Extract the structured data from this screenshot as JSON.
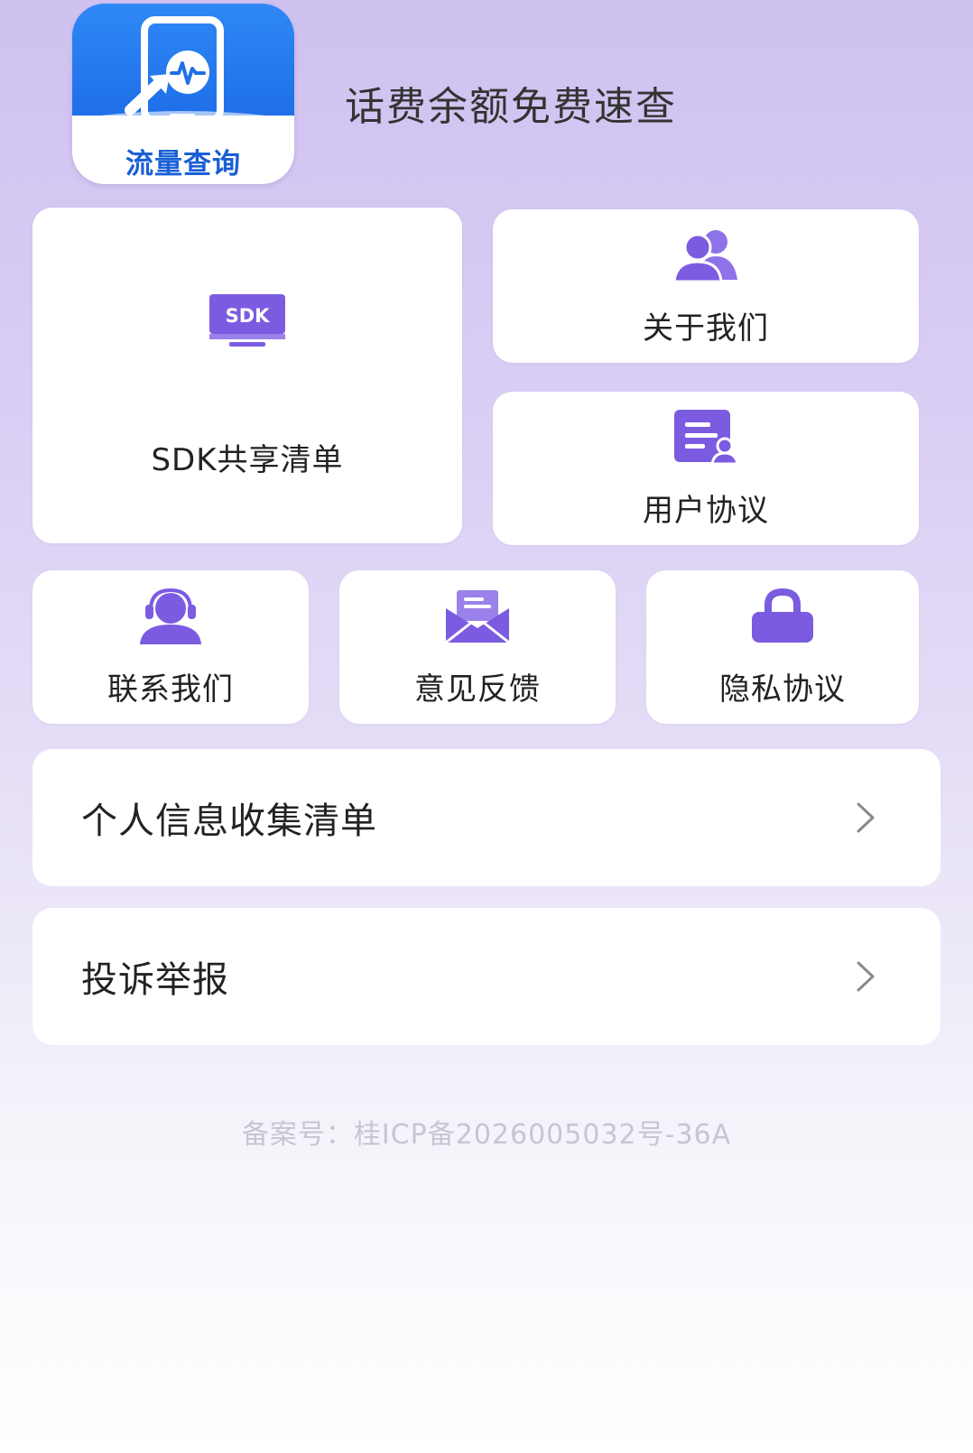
{
  "header": {
    "logo_text": "流量查询",
    "title": "话费余额免费速查"
  },
  "grid": {
    "sdk": {
      "label": "SDK共享清单",
      "icon_text": "SDK",
      "icon": "sdk-icon"
    },
    "about": {
      "label": "关于我们",
      "icon": "users-icon"
    },
    "agreement": {
      "label": "用户协议",
      "icon": "document-user-icon"
    },
    "contact": {
      "label": "联系我们",
      "icon": "headset-icon"
    },
    "feedback": {
      "label": "意见反馈",
      "icon": "envelope-icon"
    },
    "privacy": {
      "label": "隐私协议",
      "icon": "lock-icon"
    }
  },
  "list": {
    "personal_info": {
      "label": "个人信息收集清单",
      "icon": "chevron-right-icon"
    },
    "complaint": {
      "label": "投诉举报",
      "icon": "chevron-right-icon"
    }
  },
  "footer": {
    "icp": "备案号：桂ICP备2026005032号-36A"
  },
  "colors": {
    "accent": "#7b5ce0",
    "logo_blue": "#1f6fe8",
    "background_top": "#cfc1f0",
    "card": "#ffffff",
    "muted_text": "#c9c4d3"
  }
}
